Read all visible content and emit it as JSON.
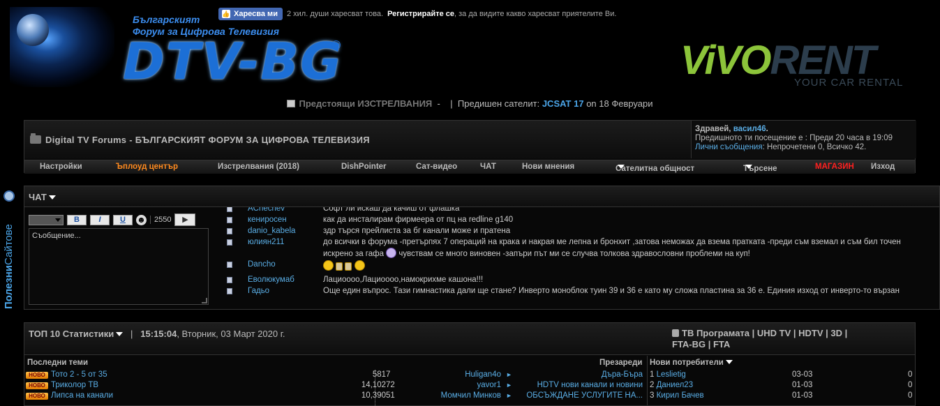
{
  "header": {
    "site_tagline_1": "Българският",
    "site_tagline_2": "Форум за Цифрова Телевизия",
    "site_logo": "DTV-BG",
    "site_logo_reg": "®",
    "fb_like_label": "Харесва ми",
    "fb_count_text": "2 хил. души харесват това.",
    "fb_register": "Регистрирайте се",
    "fb_suffix": ", за да видите какво харесват приятелите Ви.",
    "ad_brand_vivo": "ViVO",
    "ad_brand_rent": "RENT",
    "ad_sub": "YOUR CAR RENTAL"
  },
  "launch_bar": {
    "label": "Предстоящи ИЗСТРЕЛВАНИЯ",
    "dash": "-",
    "sep": "|",
    "prev_label": "Предишен сателит:",
    "satellite": "JCSAT 17",
    "date": "on 18 Февруари"
  },
  "forum": {
    "title": "Digital TV Forums - БЪЛГАРСКИЯТ ФОРУМ ЗА ЦИФРОВА ТЕЛЕВИЗИЯ",
    "greeting": "Здравей,",
    "username": "васил46",
    "greeting_end": ".",
    "last_visit": "Предишното ти посещение е : Преди 20 часа в 19:09",
    "pm_label": "Лични съобщения",
    "pm_status": ": Непрочетени 0, Всичко 42."
  },
  "nav": [
    {
      "label": "Настройки"
    },
    {
      "label": "Ъплоуд център"
    },
    {
      "label": "Изстрелвания (2018)"
    },
    {
      "label": "DishPointer"
    },
    {
      "label": "Сат-видео"
    },
    {
      "label": "ЧАТ"
    },
    {
      "label": "Нови мнения"
    },
    {
      "label": "Сателитна общност"
    },
    {
      "label": "Търсене"
    },
    {
      "label": "МАГАЗИН"
    },
    {
      "label": "Изход"
    }
  ],
  "side_tab": {
    "part1": "Полезни",
    "part2": "Сайтове"
  },
  "chat": {
    "title": "ЧАТ",
    "bold": "B",
    "italic": "I",
    "underline": "U",
    "smiley": "☻",
    "char_count": "2550",
    "send": "▶",
    "placeholder": "Съобщение...",
    "messages": [
      {
        "user": "ACnechev",
        "text": "Софт ли искаш да качиш от флашка"
      },
      {
        "user": "кенирoсен",
        "text": "как да инсталирам фирмеера от пц на redline g140"
      },
      {
        "user": "danio_kabela",
        "text": "здр търся прейлиста за бг канали може и пратена"
      },
      {
        "user": "юлиян211",
        "text": "до всички в форума -претърпях 7 операций на крака и накрая ме лепна и бронхит ,затова неможах да взема пратката -преди съм вземал и съм бил точен",
        "text2": "искрено за гафа",
        "text3": "чувствам се много виновен -запъри път ми се случва толкова здравословни проблеми на куп!"
      },
      {
        "user": "Dancho",
        "text": ""
      },
      {
        "user": "Еволюкумаб",
        "text": "Лациoooо,Лациoooо,намокрихме кашона!!!"
      },
      {
        "user": "Гадьо",
        "text": "Още един въпрос. Тази гимнастика дали ще стане? Инверто моноблок туин 39 и 36 е като му сложа пластина за 36 е. Единия изход от инверто-то вързан"
      }
    ]
  },
  "stats": {
    "title": "ТОП 10 Статистики",
    "sep": "|",
    "time": "15:15:04",
    "date": ", Вторник, 03 Март 2020 г.",
    "tv_program": "ТВ Програмата | UHD TV | HDTV | 3D |",
    "tv_program_2": "FTA-BG | FTA",
    "col_latest": "Последни теми",
    "col_loads": "Презареди",
    "col_new_users": "Нови потребители",
    "badge": "НОВО",
    "rows": [
      {
        "topic": "Тото 2 - 5 от 35",
        "replies": "581",
        "views": "7",
        "poster": "Huligan4o",
        "forum": "Дъра-Бъра",
        "nu_idx": "1",
        "nu_name": "Leslietig",
        "nu_date": "03-03",
        "nu_posts": "0"
      },
      {
        "topic": "Триколор ТВ",
        "replies": "14,102",
        "views": "72",
        "poster": "yavor1",
        "forum": "HDTV нови канали и новини",
        "nu_idx": "2",
        "nu_name": "Даниел23",
        "nu_date": "01-03",
        "nu_posts": "0"
      },
      {
        "topic": "Липса на канали",
        "replies": "10,390",
        "views": "51",
        "poster": "Момчил Минков",
        "forum": "ОБСЪЖДАНЕ УСЛУГИТЕ НА...",
        "nu_idx": "3",
        "nu_name": "Кирил Бачев",
        "nu_date": "01-03",
        "nu_posts": "0"
      }
    ]
  }
}
